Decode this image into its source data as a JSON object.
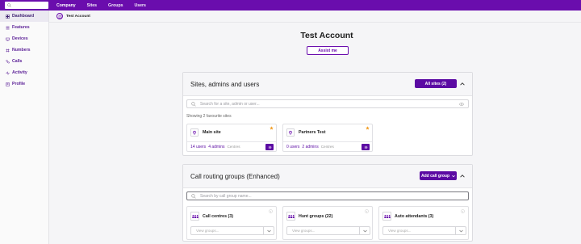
{
  "topnav": {
    "items": [
      "Company",
      "Sites",
      "Groups",
      "Users"
    ]
  },
  "sidebar": {
    "items": [
      {
        "label": "Dashboard",
        "icon": "dashboard-icon"
      },
      {
        "label": "Features",
        "icon": "features-icon"
      },
      {
        "label": "Devices",
        "icon": "devices-icon"
      },
      {
        "label": "Numbers",
        "icon": "numbers-icon"
      },
      {
        "label": "Calls",
        "icon": "calls-icon"
      },
      {
        "label": "Activity",
        "icon": "activity-icon"
      },
      {
        "label": "Profile",
        "icon": "profile-icon"
      }
    ]
  },
  "breadcrumb": {
    "label": "Test Account"
  },
  "page": {
    "title": "Test Account",
    "assist_label": "Assist me"
  },
  "sites_panel": {
    "title": "Sites, admins and users",
    "all_sites_label": "All sites (2)",
    "search_placeholder": "Search for a site, admin or user...",
    "favourites_label": "Showing 2 favourite sites",
    "cards": [
      {
        "name": "Main site",
        "users": "14 users",
        "admins": "4 admins",
        "centres": "Centres"
      },
      {
        "name": "Partners Test",
        "users": "0 users",
        "admins": "2 admins",
        "centres": "Centres"
      }
    ]
  },
  "routing_panel": {
    "title": "Call routing groups (Enhanced)",
    "add_label": "Add call group",
    "search_placeholder": "Search by call group name...",
    "groups": [
      {
        "name": "Call centres (3)",
        "select_placeholder": "View groups..."
      },
      {
        "name": "Hunt groups (22)",
        "select_placeholder": "View groups..."
      },
      {
        "name": "Auto attendants (3)",
        "select_placeholder": "View groups..."
      }
    ]
  },
  "colors": {
    "brand": "#6a0dad",
    "button": "#5b0aa3",
    "star": "#f2a02a"
  }
}
